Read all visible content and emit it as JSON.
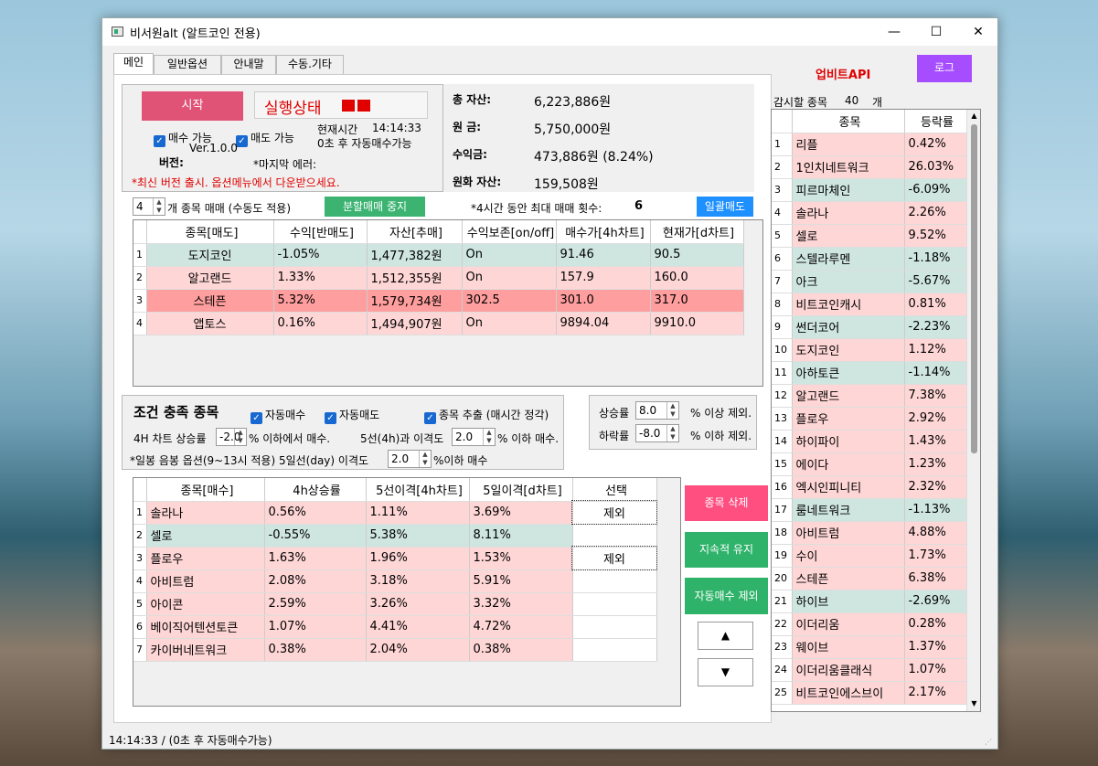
{
  "window": {
    "title": "비서원alt (알트코인 전용)",
    "minimize": "—",
    "maximize": "☐",
    "close": "✕"
  },
  "tabs": [
    "메인",
    "일반옵션",
    "안내말",
    "수동.기타"
  ],
  "controls": {
    "start": "시작",
    "status_label": "실행상태",
    "buy_enabled": "매수 가능",
    "sell_enabled": "매도 가능",
    "version_label": "버전:",
    "version": "Ver.1.0.0",
    "current_time_label": "현재시간",
    "current_time": "14:14:33",
    "auto_buy_note": "0초 후 자동매수가능",
    "last_error_label": "*마지막 에러:",
    "update_notice": "*최신 버전 출시. 옵션메뉴에서 다운받으세요."
  },
  "assets": {
    "total_label": "총 자산:",
    "total": "6,223,886원",
    "principal_label": "원    금:",
    "principal": "5,750,000원",
    "profit_label": "수익금:",
    "profit": "473,886원 (8.24%)",
    "krw_label": "원화 자산:",
    "krw": "159,508원"
  },
  "trade_bar": {
    "count": "4",
    "count_label": "개 종목 매매 (수동도 적용)",
    "split_stop": "분할매매 중지",
    "max_trades_label": "*4시간 동안 최대 매매 횟수:",
    "max_trades": "6",
    "sell_all": "일괄매도"
  },
  "holdings": {
    "headers": [
      "종목[매도]",
      "수익[반매도]",
      "자산[추매]",
      "수익보존[on/off]",
      "매수가[4h차트]",
      "현재가[d차트]"
    ],
    "rows": [
      {
        "n": "1",
        "name": "도지코인",
        "profit": "-1.05%",
        "asset": "1,477,382원",
        "keep": "On",
        "buy": "91.46",
        "cur": "90.5",
        "style": "teal"
      },
      {
        "n": "2",
        "name": "알고랜드",
        "profit": "1.33%",
        "asset": "1,512,355원",
        "keep": "On",
        "buy": "157.9",
        "cur": "160.0",
        "style": "pink"
      },
      {
        "n": "3",
        "name": "스테픈",
        "profit": "5.32%",
        "asset": "1,579,734원",
        "keep": "302.5",
        "buy": "301.0",
        "cur": "317.0",
        "style": "hot"
      },
      {
        "n": "4",
        "name": "앱토스",
        "profit": "0.16%",
        "asset": "1,494,907원",
        "keep": "On",
        "buy": "9894.04",
        "cur": "9910.0",
        "style": "pink"
      }
    ]
  },
  "conditions": {
    "title": "조건 충족 종목",
    "auto_buy": "자동매수",
    "auto_sell": "자동매도",
    "extract": "종목 추출 (매시간 정각)",
    "rise_label": "상승률",
    "rise_value": "8.0",
    "rise_suffix": "% 이상 제외.",
    "fall_label": "하락률",
    "fall_value": "-8.0",
    "fall_suffix": "% 이하 제외.",
    "h4_label": "4H 차트 상승률",
    "h4_value": "-2.0",
    "h4_suffix": "% 이하에서 매수.",
    "ma5_label": "5선(4h)과 이격도",
    "ma5_value": "2.0",
    "ma5_suffix": "% 이하 매수.",
    "daily_label": "*일봉 음봉 옵션(9~13시 적용) 5일선(day) 이격도",
    "daily_value": "2.0",
    "daily_suffix": "%이하 매수"
  },
  "candidates": {
    "headers": [
      "종목[매수]",
      "4h상승률",
      "5선이격[4h차트]",
      "5일이격[d차트]",
      "선택"
    ],
    "rows": [
      {
        "n": "1",
        "name": "솔라나",
        "h4": "0.56%",
        "ma5": "1.11%",
        "d5": "3.69%",
        "sel": "제외",
        "style": "pink"
      },
      {
        "n": "2",
        "name": "셀로",
        "h4": "-0.55%",
        "ma5": "5.38%",
        "d5": "8.11%",
        "sel": "",
        "style": "teal"
      },
      {
        "n": "3",
        "name": "플로우",
        "h4": "1.63%",
        "ma5": "1.96%",
        "d5": "1.53%",
        "sel": "제외",
        "style": "pink"
      },
      {
        "n": "4",
        "name": "아비트럼",
        "h4": "2.08%",
        "ma5": "3.18%",
        "d5": "5.91%",
        "sel": "",
        "style": "pink"
      },
      {
        "n": "5",
        "name": "아이콘",
        "h4": "2.59%",
        "ma5": "3.26%",
        "d5": "3.32%",
        "sel": "",
        "style": "pink"
      },
      {
        "n": "6",
        "name": "베이직어텐션토큰",
        "h4": "1.07%",
        "ma5": "4.41%",
        "d5": "4.72%",
        "sel": "",
        "style": "pink"
      },
      {
        "n": "7",
        "name": "카이버네트워크",
        "h4": "0.38%",
        "ma5": "2.04%",
        "d5": "0.38%",
        "sel": "",
        "style": "pink"
      }
    ]
  },
  "side_buttons": {
    "delete": "종목 삭제",
    "keep": "지속적 유지",
    "exclude": "자동매수 제외",
    "up": "▲",
    "down": "▼"
  },
  "right": {
    "api": "업비트API",
    "log": "로그",
    "watch_label": "감시할 종목",
    "watch_count": "40",
    "watch_unit": "개",
    "headers": [
      "종목",
      "등락률"
    ],
    "rows": [
      {
        "n": "1",
        "name": "리플",
        "r": "0.42%",
        "style": "pink"
      },
      {
        "n": "2",
        "name": "1인치네트워크",
        "r": "26.03%",
        "style": "pink"
      },
      {
        "n": "3",
        "name": "피르마체인",
        "r": "-6.09%",
        "style": "teal"
      },
      {
        "n": "4",
        "name": "솔라나",
        "r": "2.26%",
        "style": "pink"
      },
      {
        "n": "5",
        "name": "셀로",
        "r": "9.52%",
        "style": "pink"
      },
      {
        "n": "6",
        "name": "스텔라루멘",
        "r": "-1.18%",
        "style": "teal"
      },
      {
        "n": "7",
        "name": "아크",
        "r": "-5.67%",
        "style": "teal"
      },
      {
        "n": "8",
        "name": "비트코인캐시",
        "r": "0.81%",
        "style": "pink"
      },
      {
        "n": "9",
        "name": "썬더코어",
        "r": "-2.23%",
        "style": "teal"
      },
      {
        "n": "10",
        "name": "도지코인",
        "r": "1.12%",
        "style": "pink"
      },
      {
        "n": "11",
        "name": "아하토큰",
        "r": "-1.14%",
        "style": "teal"
      },
      {
        "n": "12",
        "name": "알고랜드",
        "r": "7.38%",
        "style": "pink"
      },
      {
        "n": "13",
        "name": "플로우",
        "r": "2.92%",
        "style": "pink"
      },
      {
        "n": "14",
        "name": "하이파이",
        "r": "1.43%",
        "style": "pink"
      },
      {
        "n": "15",
        "name": "에이다",
        "r": "1.23%",
        "style": "pink"
      },
      {
        "n": "16",
        "name": "엑시인피니티",
        "r": "2.32%",
        "style": "pink"
      },
      {
        "n": "17",
        "name": "룸네트워크",
        "r": "-1.13%",
        "style": "teal"
      },
      {
        "n": "18",
        "name": "아비트럼",
        "r": "4.88%",
        "style": "pink"
      },
      {
        "n": "19",
        "name": "수이",
        "r": "1.73%",
        "style": "pink"
      },
      {
        "n": "20",
        "name": "스테픈",
        "r": "6.38%",
        "style": "pink"
      },
      {
        "n": "21",
        "name": "하이브",
        "r": "-2.69%",
        "style": "teal"
      },
      {
        "n": "22",
        "name": "이더리움",
        "r": "0.28%",
        "style": "pink"
      },
      {
        "n": "23",
        "name": "웨이브",
        "r": "1.37%",
        "style": "pink"
      },
      {
        "n": "24",
        "name": "이더리움클래식",
        "r": "1.07%",
        "style": "pink"
      },
      {
        "n": "25",
        "name": "비트코인에스브이",
        "r": "2.17%",
        "style": "pink"
      }
    ]
  },
  "statusbar": "14:14:33 / (0초 후 자동매수가능)",
  "colors": {
    "start": "#e05276",
    "split": "#3cb371",
    "sellall": "#1e90ff",
    "api": "#e00000",
    "log": "#a64dff",
    "delete_btn": "#ff4f81",
    "green_btn": "#2fb36a",
    "pink_row": "#ffd6d6",
    "teal_row": "#cfe6e0",
    "hot_row": "#ff9e9e"
  }
}
